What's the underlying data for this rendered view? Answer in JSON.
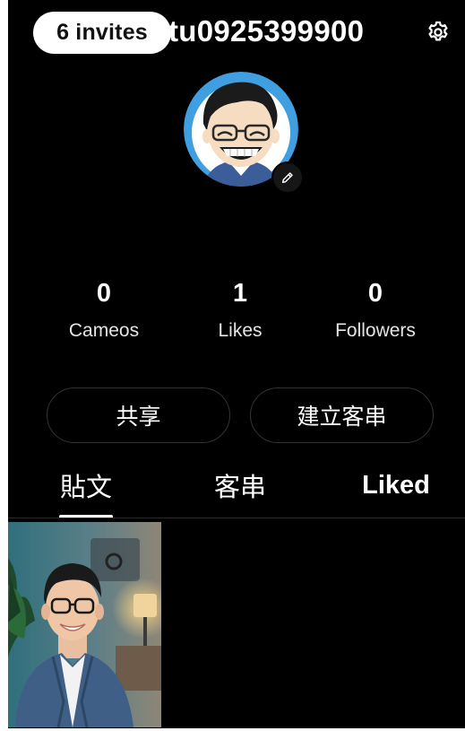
{
  "header": {
    "invites_label": "6 invites",
    "username": "tu0925399900"
  },
  "icons": {
    "settings": "gear-icon",
    "edit_avatar": "pencil-icon"
  },
  "stats": [
    {
      "value": "0",
      "label": "Cameos"
    },
    {
      "value": "1",
      "label": "Likes"
    },
    {
      "value": "0",
      "label": "Followers"
    }
  ],
  "actions": {
    "share_label": "共享",
    "create_label": "建立客串"
  },
  "tabs": [
    {
      "label": "貼文",
      "active": true
    },
    {
      "label": "客串",
      "active": false
    },
    {
      "label": "Liked",
      "active": false
    }
  ],
  "colors": {
    "background": "#000000",
    "pill_bg": "#ffffff",
    "avatar_ring": "#3f9fe0"
  }
}
